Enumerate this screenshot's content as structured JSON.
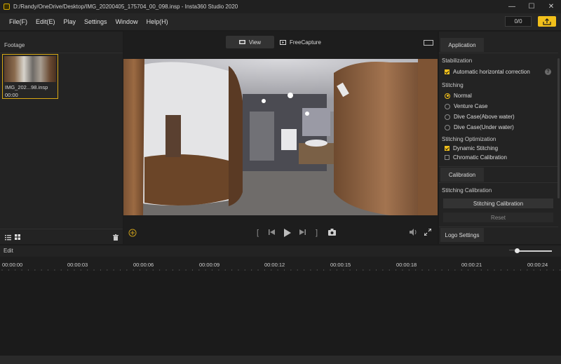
{
  "titlebar": {
    "title": "D:/Randy/OneDrive/Desktop/IMG_20200405_175704_00_098.insp - Insta360 Studio 2020",
    "minimize": "—",
    "maximize": "☐",
    "close": "✕"
  },
  "menu": {
    "items": [
      "File(F)",
      "Edit(E)",
      "Play",
      "Settings",
      "Window",
      "Help(H)"
    ],
    "task_count": "0/0"
  },
  "footage": {
    "title": "Footage",
    "items": [
      {
        "name": "IMG_202...98.insp",
        "duration": "00:00"
      }
    ]
  },
  "viewer": {
    "view_label": "View",
    "freecapture_label": "FreeCapture",
    "controls": {
      "mark_in": "[",
      "mark_out": "]"
    }
  },
  "settings": {
    "application_tab": "Application",
    "stabilization_heading": "Stabilization",
    "auto_horizontal": "Automatic horizontal correction",
    "help_glyph": "?",
    "stitching_heading": "Stitching",
    "stitching_options": [
      {
        "label": "Normal",
        "selected": true
      },
      {
        "label": "Venture Case",
        "selected": false
      },
      {
        "label": "Dive Case(Above water)",
        "selected": false
      },
      {
        "label": "Dive Case(Under water)",
        "selected": false
      }
    ],
    "optimization_heading": "Stitching Optimization",
    "dynamic_stitching": "Dynamic Stitching",
    "chromatic_calibration": "Chromatic Calibration",
    "calibration_tab": "Calibration",
    "stitching_calibration_heading": "Stitching Calibration",
    "stitching_calibration_button": "Stitching Calibration",
    "reset_button": "Reset",
    "logo_settings_tab": "Logo Settings"
  },
  "timeline": {
    "label": "Edit",
    "zoom_minus": "—",
    "ticks": [
      "00:00:00",
      "00:00:03",
      "00:00:06",
      "00:00:09",
      "00:00:12",
      "00:00:15",
      "00:00:18",
      "00:00:21",
      "00:00:24"
    ]
  },
  "colors": {
    "accent": "#f2c01b",
    "background": "#1b1b1b",
    "panel": "#232323"
  }
}
